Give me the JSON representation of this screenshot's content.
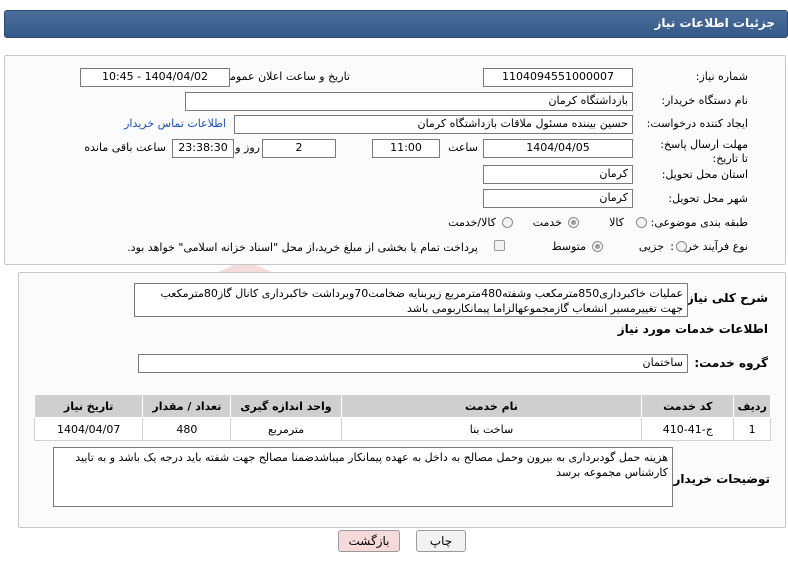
{
  "header": {
    "title": "جزئیات اطلاعات نیاز"
  },
  "form": {
    "need_number_label": "شماره نیاز:",
    "need_number": "1104094551000007",
    "announce_label": "تاریخ و ساعت اعلان عمومی:",
    "announce_value": "1404/04/02 - 10:45",
    "buyer_org_label": "نام دستگاه خریدار:",
    "buyer_org": "بازداشتگاه کرمان",
    "creator_label": "ایجاد کننده درخواست:",
    "creator": "حسین بیننده مسئول ملاقات بازداشتگاه کرمان",
    "contact_link": "اطلاعات تماس خریدار",
    "deadline_label": "مهلت ارسال پاسخ: تا تاریخ:",
    "deadline_date": "1404/04/05",
    "time_label": "ساعت",
    "deadline_time": "11:00",
    "days_value": "2",
    "days_label": "روز و",
    "remaining_time": "23:38:30",
    "remaining_label": "ساعت باقی مانده",
    "province_label": "استان محل تحویل:",
    "province": "کرمان",
    "city_label": "شهر محل تحویل:",
    "city": "کرمان",
    "category_label": "طبقه بندی موضوعی:",
    "category_options": [
      "کالا",
      "خدمت",
      "کالا/خدمت"
    ],
    "category_selected": "خدمت",
    "process_label": "نوع فرآیند خرید :",
    "process_options": [
      "جزیی",
      "متوسط"
    ],
    "process_selected": "متوسط",
    "payment_note": "پرداخت تمام یا بخشی از مبلغ خرید،از محل \"اسناد خزانه اسلامی\" خواهد بود."
  },
  "summary": {
    "label": "شرح کلی نیاز:",
    "text": "عملیات خاکبرداری850مترمکعب وشفته480مترمربع زیربنایه ضخامت70وبرداشت خاکبرداری کانال گاز80مترمکعب جهت تغییرمسیر انشعاب گازمجموعهالزاما پیمانکاربومی باشد"
  },
  "services": {
    "section_title": "اطلاعات خدمات مورد نیاز",
    "group_label": "گروه خدمت:",
    "group_value": "ساختمان",
    "columns": [
      "ردیف",
      "کد خدمت",
      "نام خدمت",
      "واحد اندازه گیری",
      "تعداد / مقدار",
      "تاریخ نیاز"
    ],
    "rows": [
      [
        "1",
        "ج-41-410",
        "ساخت بنا",
        "مترمربع",
        "480",
        "1404/04/07"
      ]
    ]
  },
  "buyer_notes": {
    "label": "توضیحات خریدار:",
    "text": "هزینه حمل گودبرداری به بیرون وحمل مصالح به داخل به عهده پیمانکار میباشدضمنا مصالح جهت شفته باید درجه یک باشد و به تایید کارشناس مجموعه برسد"
  },
  "buttons": {
    "print": "چاپ",
    "back": "بازگشت"
  },
  "colors": {
    "title_bar": "#365a88",
    "link": "#1a4fb5",
    "back_button_bg": "#f6d9d9"
  }
}
